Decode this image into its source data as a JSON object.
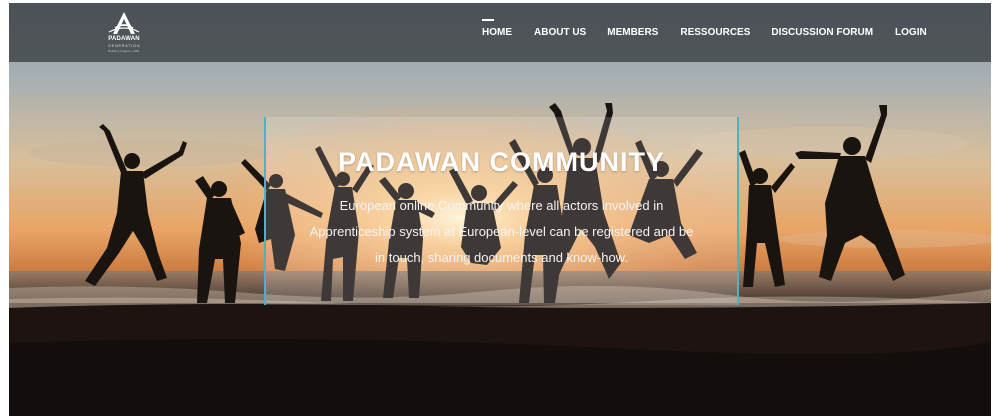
{
  "brand": {
    "name": "PADAWAN",
    "subname": "GENERATION",
    "tagline": "Building bridges in WBL"
  },
  "nav": {
    "items": [
      {
        "label": "HOME",
        "active": true
      },
      {
        "label": "ABOUT US",
        "active": false
      },
      {
        "label": "MEMBERS",
        "active": false
      },
      {
        "label": "RESSOURCES",
        "active": false
      },
      {
        "label": "DISCUSSION FORUM",
        "active": false
      },
      {
        "label": "LOGIN",
        "active": false
      }
    ]
  },
  "hero": {
    "title": "PADAWAN COMMUNITY",
    "description": "European online Community where all actors involved in Apprenticeship system at European-level can be registered and be in touch, sharing documents and know-how."
  },
  "colors": {
    "accent": "#4ab3c5",
    "navbar": "#3a3c40",
    "text": "#ffffff"
  },
  "icons": {
    "logo": "padawan-logo-icon"
  }
}
